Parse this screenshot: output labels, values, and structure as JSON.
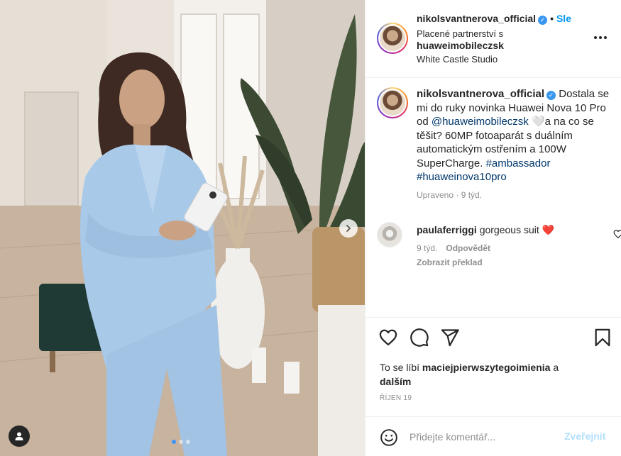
{
  "post": {
    "username": "nikolsvantnerova_official",
    "follow_label": "Sle",
    "sponsored_label": "Placené partnerství s",
    "partner": "huaweimobileczsk",
    "location": "White Castle Studio"
  },
  "caption": {
    "username": "nikolsvantnerova_official",
    "text_part1": "Dostala se mi do ruky novinka Huawei Nova 10 Pro od ",
    "mention": "@huaweimobileczsk",
    "text_part2": " 🤍a na co se těšit? 60MP fotoaparát s duálním automatickým ostřením a 100W SuperCharge. ",
    "hashtag1": "#ambassador",
    "hashtag2": "#huaweinova10pro",
    "edited_label": "Upraveno",
    "time": "9 týd."
  },
  "comment": {
    "username": "paulaferriggi",
    "text": "gorgeous suit ❤️",
    "time": "9 týd.",
    "reply_label": "Odpovědět",
    "translate_label": "Zobrazit překlad"
  },
  "likes": {
    "prefix": "To se líbí",
    "user": "maciejpierwszytegoimienia",
    "connector": "a",
    "others": "dalším"
  },
  "date": "ŘÍJEN 19",
  "add_comment": {
    "placeholder": "Přidejte komentář...",
    "post_label": "Zveřejnit"
  },
  "carousel": {
    "slides": 3,
    "active": 1
  },
  "icons": [
    "heart-icon",
    "comment-icon",
    "share-icon",
    "bookmark-icon",
    "emoji-icon",
    "more-icon",
    "user-tag-icon",
    "chevron-right-icon",
    "verified-icon"
  ],
  "colors": {
    "link": "#00376b",
    "accent": "#0095f6",
    "post_disabled": "#b2dffc",
    "muted": "#8e8e8e",
    "verified": "#3897f0",
    "suit": "#a9c9e8"
  }
}
